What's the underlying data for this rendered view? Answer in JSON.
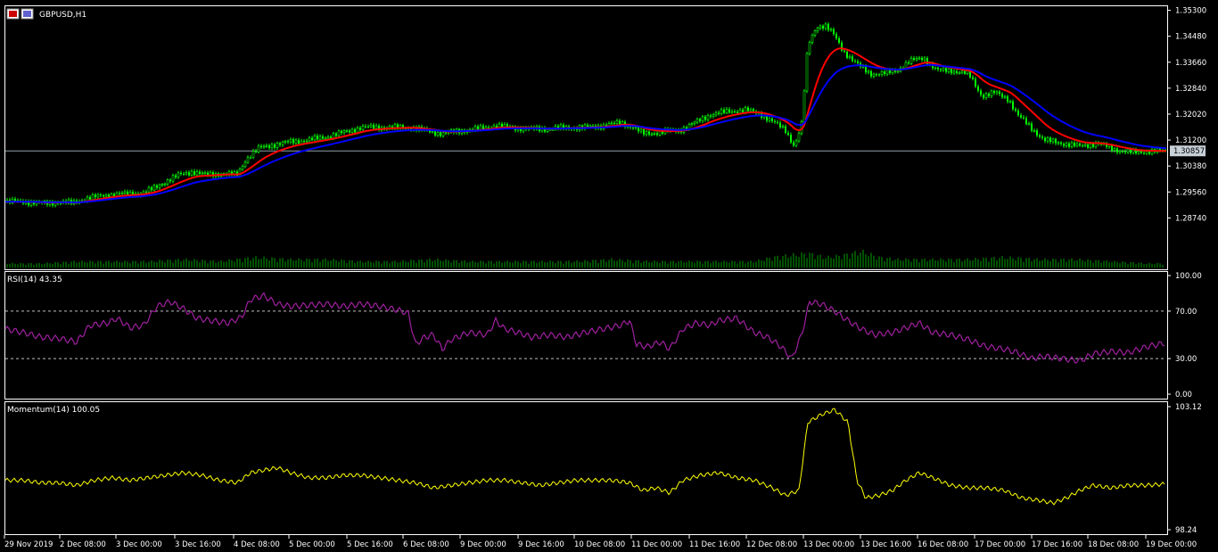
{
  "title": {
    "label": "GBPUSD,H1"
  },
  "colors": {
    "background": "#000000",
    "frame": "#ffffff",
    "candle_up": "#00ff00",
    "candle_down": "#00ff00",
    "ma_fast": "#ff0000",
    "ma_slow": "#0000ff",
    "bid_line": "#8f9fa8",
    "volume": "#00a000",
    "rsi": "#a020a0",
    "momentum": "#ffff00",
    "level": "#c0c0c0"
  },
  "price_axis": {
    "ticks": [
      "1.35300",
      "1.34480",
      "1.33660",
      "1.32840",
      "1.32020",
      "1.31200",
      "1.30380",
      "1.29560",
      "1.28740"
    ],
    "min": 1.283,
    "max": 1.354,
    "current_price": "1.30857"
  },
  "rsi_panel": {
    "label": "RSI(14) 43.35",
    "ticks": [
      "100.00",
      "70.00",
      "30.00",
      "0.00"
    ],
    "levels": [
      70,
      30
    ]
  },
  "momentum_panel": {
    "label": "Momentum(14) 100.05",
    "ticks": [
      "103.12",
      "98.24"
    ],
    "min": 98.24,
    "max": 103.12
  },
  "time_axis": {
    "labels": [
      "29 Nov 2019",
      "2 Dec 08:00",
      "3 Dec 00:00",
      "3 Dec 16:00",
      "4 Dec 08:00",
      "5 Dec 00:00",
      "5 Dec 16:00",
      "6 Dec 08:00",
      "9 Dec 00:00",
      "9 Dec 16:00",
      "10 Dec 08:00",
      "11 Dec 00:00",
      "11 Dec 16:00",
      "12 Dec 08:00",
      "13 Dec 00:00",
      "13 Dec 16:00",
      "16 Dec 08:00",
      "17 Dec 00:00",
      "17 Dec 16:00",
      "18 Dec 08:00",
      "19 Dec 00:00"
    ]
  },
  "chart_data": {
    "type": "line",
    "price_path": [
      [
        0,
        1.2925
      ],
      [
        22,
        1.2925
      ],
      [
        45,
        1.292
      ],
      [
        60,
        1.2925
      ],
      [
        75,
        1.292
      ],
      [
        90,
        1.2935
      ],
      [
        110,
        1.2945
      ],
      [
        130,
        1.295
      ],
      [
        150,
        1.295
      ],
      [
        165,
        1.2965
      ],
      [
        180,
        1.299
      ],
      [
        195,
        1.301
      ],
      [
        210,
        1.302
      ],
      [
        225,
        1.301
      ],
      [
        245,
        1.3015
      ],
      [
        260,
        1.301
      ],
      [
        270,
        1.306
      ],
      [
        285,
        1.3095
      ],
      [
        300,
        1.3105
      ],
      [
        320,
        1.3115
      ],
      [
        340,
        1.312
      ],
      [
        360,
        1.313
      ],
      [
        380,
        1.3145
      ],
      [
        400,
        1.316
      ],
      [
        420,
        1.316
      ],
      [
        440,
        1.316
      ],
      [
        455,
        1.316
      ],
      [
        470,
        1.315
      ],
      [
        490,
        1.314
      ],
      [
        510,
        1.315
      ],
      [
        530,
        1.3155
      ],
      [
        550,
        1.3165
      ],
      [
        570,
        1.316
      ],
      [
        590,
        1.3155
      ],
      [
        610,
        1.3155
      ],
      [
        630,
        1.316
      ],
      [
        650,
        1.316
      ],
      [
        670,
        1.3165
      ],
      [
        690,
        1.3175
      ],
      [
        705,
        1.316
      ],
      [
        715,
        1.314
      ],
      [
        735,
        1.3145
      ],
      [
        755,
        1.315
      ],
      [
        770,
        1.317
      ],
      [
        790,
        1.32
      ],
      [
        810,
        1.321
      ],
      [
        830,
        1.3215
      ],
      [
        845,
        1.3205
      ],
      [
        860,
        1.318
      ],
      [
        875,
        1.315
      ],
      [
        885,
        1.31
      ],
      [
        893,
        1.317
      ],
      [
        900,
        1.342
      ],
      [
        910,
        1.348
      ],
      [
        920,
        1.348
      ],
      [
        930,
        1.345
      ],
      [
        940,
        1.34
      ],
      [
        955,
        1.336
      ],
      [
        970,
        1.333
      ],
      [
        985,
        1.333
      ],
      [
        1000,
        1.334
      ],
      [
        1015,
        1.337
      ],
      [
        1030,
        1.338
      ],
      [
        1045,
        1.334
      ],
      [
        1060,
        1.334
      ],
      [
        1080,
        1.333
      ],
      [
        1095,
        1.326
      ],
      [
        1110,
        1.327
      ],
      [
        1125,
        1.325
      ],
      [
        1135,
        1.32
      ],
      [
        1150,
        1.316
      ],
      [
        1165,
        1.312
      ],
      [
        1185,
        1.311
      ],
      [
        1205,
        1.31
      ],
      [
        1225,
        1.311
      ],
      [
        1245,
        1.309
      ],
      [
        1265,
        1.308
      ],
      [
        1285,
        1.3085
      ],
      [
        1305,
        1.3086
      ]
    ],
    "rsi": [
      [
        0,
        55
      ],
      [
        20,
        52
      ],
      [
        40,
        48
      ],
      [
        60,
        47
      ],
      [
        80,
        44
      ],
      [
        95,
        58
      ],
      [
        115,
        60
      ],
      [
        125,
        64
      ],
      [
        140,
        56
      ],
      [
        155,
        58
      ],
      [
        170,
        74
      ],
      [
        185,
        78
      ],
      [
        200,
        72
      ],
      [
        215,
        64
      ],
      [
        230,
        62
      ],
      [
        250,
        60
      ],
      [
        265,
        65
      ],
      [
        275,
        80
      ],
      [
        290,
        83
      ],
      [
        305,
        76
      ],
      [
        320,
        74
      ],
      [
        340,
        75
      ],
      [
        360,
        76
      ],
      [
        380,
        74
      ],
      [
        400,
        76
      ],
      [
        420,
        74
      ],
      [
        440,
        71
      ],
      [
        452,
        68
      ],
      [
        460,
        42
      ],
      [
        470,
        48
      ],
      [
        480,
        50
      ],
      [
        490,
        38
      ],
      [
        500,
        46
      ],
      [
        520,
        52
      ],
      [
        540,
        50
      ],
      [
        550,
        62
      ],
      [
        560,
        55
      ],
      [
        575,
        52
      ],
      [
        590,
        48
      ],
      [
        610,
        50
      ],
      [
        630,
        48
      ],
      [
        650,
        52
      ],
      [
        670,
        55
      ],
      [
        690,
        58
      ],
      [
        700,
        62
      ],
      [
        708,
        42
      ],
      [
        720,
        40
      ],
      [
        735,
        44
      ],
      [
        745,
        38
      ],
      [
        760,
        55
      ],
      [
        775,
        60
      ],
      [
        790,
        58
      ],
      [
        800,
        62
      ],
      [
        820,
        64
      ],
      [
        840,
        52
      ],
      [
        855,
        48
      ],
      [
        870,
        40
      ],
      [
        882,
        30
      ],
      [
        893,
        50
      ],
      [
        902,
        78
      ],
      [
        915,
        76
      ],
      [
        930,
        70
      ],
      [
        945,
        62
      ],
      [
        960,
        55
      ],
      [
        975,
        50
      ],
      [
        995,
        52
      ],
      [
        1010,
        56
      ],
      [
        1025,
        60
      ],
      [
        1040,
        52
      ],
      [
        1060,
        50
      ],
      [
        1080,
        46
      ],
      [
        1100,
        40
      ],
      [
        1120,
        38
      ],
      [
        1135,
        35
      ],
      [
        1150,
        30
      ],
      [
        1165,
        32
      ],
      [
        1185,
        30
      ],
      [
        1205,
        28
      ],
      [
        1220,
        34
      ],
      [
        1240,
        36
      ],
      [
        1260,
        35
      ],
      [
        1280,
        40
      ],
      [
        1300,
        43
      ]
    ],
    "momentum": [
      [
        0,
        100.2
      ],
      [
        20,
        100.2
      ],
      [
        40,
        100.1
      ],
      [
        60,
        100.1
      ],
      [
        80,
        100.0
      ],
      [
        100,
        100.2
      ],
      [
        120,
        100.3
      ],
      [
        140,
        100.2
      ],
      [
        160,
        100.3
      ],
      [
        180,
        100.4
      ],
      [
        200,
        100.5
      ],
      [
        220,
        100.4
      ],
      [
        240,
        100.2
      ],
      [
        260,
        100.1
      ],
      [
        275,
        100.5
      ],
      [
        290,
        100.6
      ],
      [
        305,
        100.7
      ],
      [
        320,
        100.5
      ],
      [
        340,
        100.3
      ],
      [
        360,
        100.3
      ],
      [
        380,
        100.4
      ],
      [
        400,
        100.4
      ],
      [
        420,
        100.3
      ],
      [
        440,
        100.2
      ],
      [
        460,
        100.1
      ],
      [
        480,
        99.9
      ],
      [
        500,
        100.0
      ],
      [
        520,
        100.1
      ],
      [
        540,
        100.2
      ],
      [
        560,
        100.2
      ],
      [
        580,
        100.1
      ],
      [
        600,
        100.0
      ],
      [
        620,
        100.1
      ],
      [
        640,
        100.2
      ],
      [
        660,
        100.2
      ],
      [
        680,
        100.2
      ],
      [
        700,
        100.1
      ],
      [
        715,
        99.8
      ],
      [
        730,
        99.9
      ],
      [
        745,
        99.7
      ],
      [
        760,
        100.2
      ],
      [
        780,
        100.4
      ],
      [
        800,
        100.5
      ],
      [
        820,
        100.3
      ],
      [
        840,
        100.2
      ],
      [
        860,
        99.9
      ],
      [
        875,
        99.6
      ],
      [
        890,
        99.8
      ],
      [
        900,
        102.5
      ],
      [
        915,
        102.8
      ],
      [
        930,
        103.0
      ],
      [
        945,
        102.5
      ],
      [
        955,
        100.2
      ],
      [
        965,
        99.5
      ],
      [
        980,
        99.6
      ],
      [
        995,
        99.8
      ],
      [
        1010,
        100.2
      ],
      [
        1025,
        100.5
      ],
      [
        1040,
        100.3
      ],
      [
        1060,
        100.0
      ],
      [
        1080,
        99.9
      ],
      [
        1100,
        99.9
      ],
      [
        1120,
        99.8
      ],
      [
        1140,
        99.5
      ],
      [
        1160,
        99.4
      ],
      [
        1175,
        99.3
      ],
      [
        1190,
        99.5
      ],
      [
        1205,
        99.8
      ],
      [
        1220,
        100.0
      ],
      [
        1240,
        99.9
      ],
      [
        1260,
        100.0
      ],
      [
        1280,
        100.0
      ],
      [
        1300,
        100.05
      ]
    ],
    "volume": [
      [
        0,
        2
      ],
      [
        40,
        2
      ],
      [
        80,
        3
      ],
      [
        120,
        3
      ],
      [
        160,
        3
      ],
      [
        200,
        4
      ],
      [
        240,
        3
      ],
      [
        280,
        5
      ],
      [
        320,
        4
      ],
      [
        360,
        4
      ],
      [
        400,
        3
      ],
      [
        440,
        3
      ],
      [
        480,
        4
      ],
      [
        520,
        3
      ],
      [
        560,
        3
      ],
      [
        600,
        3
      ],
      [
        640,
        3
      ],
      [
        680,
        4
      ],
      [
        720,
        3
      ],
      [
        760,
        3
      ],
      [
        800,
        3
      ],
      [
        840,
        3
      ],
      [
        860,
        5
      ],
      [
        880,
        6
      ],
      [
        900,
        7
      ],
      [
        920,
        5
      ],
      [
        940,
        6
      ],
      [
        960,
        8
      ],
      [
        980,
        5
      ],
      [
        1000,
        4
      ],
      [
        1040,
        4
      ],
      [
        1080,
        4
      ],
      [
        1120,
        5
      ],
      [
        1160,
        4
      ],
      [
        1200,
        4
      ],
      [
        1240,
        3
      ],
      [
        1280,
        2
      ],
      [
        1305,
        2
      ]
    ]
  }
}
